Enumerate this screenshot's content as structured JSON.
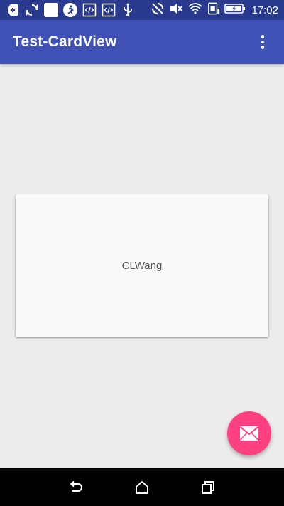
{
  "status_bar": {
    "time": "17:02",
    "icons": [
      "add-icon",
      "sync-icon",
      "blank-square-icon",
      "running-icon",
      "code-icon",
      "code-icon",
      "usb-icon",
      "sync-off-icon",
      "mute-icon",
      "wifi-icon",
      "sim-icon",
      "battery-charging-icon"
    ]
  },
  "app_bar": {
    "title": "Test-CardView",
    "overflow_icon": "more-vert-icon"
  },
  "card": {
    "text": "CLWang"
  },
  "fab": {
    "icon": "email-icon",
    "color": "#ff4081"
  },
  "nav_bar": {
    "buttons": [
      "back-icon",
      "home-icon",
      "recents-icon"
    ]
  },
  "colors": {
    "primary": "#3f51b5",
    "primary_dark": "#2a3b8f",
    "accent": "#ff4081",
    "background": "#ececec"
  }
}
